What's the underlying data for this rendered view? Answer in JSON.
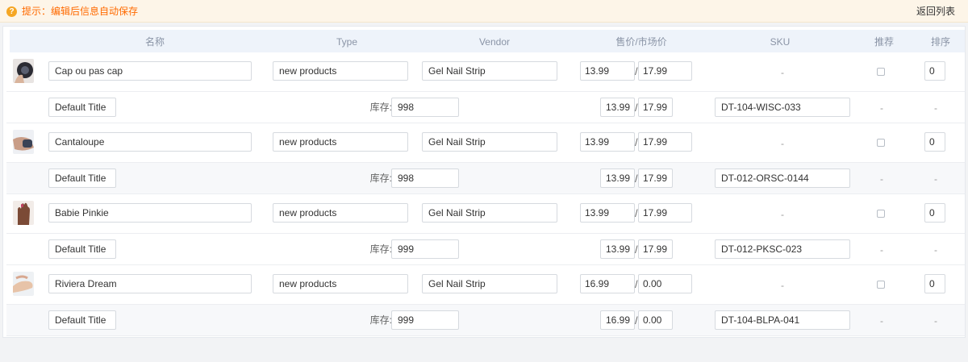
{
  "tip": {
    "icon": "question-icon",
    "text": "提示：编辑后信息自动保存"
  },
  "back_label": "返回列表",
  "columns": {
    "name": "名称",
    "type": "Type",
    "vendor": "Vendor",
    "price": "售价/市场价",
    "sku": "SKU",
    "recommend": "推荐",
    "sort": "排序"
  },
  "stock_label": "库存:",
  "placeholder_dash": "-",
  "products": [
    {
      "thumb": "product-thumb-cap",
      "name": "Cap ou pas cap",
      "type": "new products",
      "vendor": "Gel Nail Strip",
      "price": "13.99",
      "market_price": "17.99",
      "sort": "0",
      "variant": {
        "title": "Default Title",
        "stock": "998",
        "price": "13.99",
        "market_price": "17.99",
        "sku": "DT-104-WISC-033"
      }
    },
    {
      "thumb": "product-thumb-cantaloupe",
      "name": "Cantaloupe",
      "type": "new products",
      "vendor": "Gel Nail Strip",
      "price": "13.99",
      "market_price": "17.99",
      "sort": "0",
      "variant": {
        "title": "Default Title",
        "stock": "998",
        "price": "13.99",
        "market_price": "17.99",
        "sku": "DT-012-ORSC-0144"
      }
    },
    {
      "thumb": "product-thumb-babie-pinkie",
      "name": "Babie Pinkie",
      "type": "new products",
      "vendor": "Gel Nail Strip",
      "price": "13.99",
      "market_price": "17.99",
      "sort": "0",
      "variant": {
        "title": "Default Title",
        "stock": "999",
        "price": "13.99",
        "market_price": "17.99",
        "sku": "DT-012-PKSC-023"
      }
    },
    {
      "thumb": "product-thumb-riviera-dream",
      "name": "Riviera Dream",
      "type": "new products",
      "vendor": "Gel Nail Strip",
      "price": "16.99",
      "market_price": "0.00",
      "sort": "0",
      "variant": {
        "title": "Default Title",
        "stock": "999",
        "price": "16.99",
        "market_price": "0.00",
        "sku": "DT-104-BLPA-041"
      }
    }
  ]
}
